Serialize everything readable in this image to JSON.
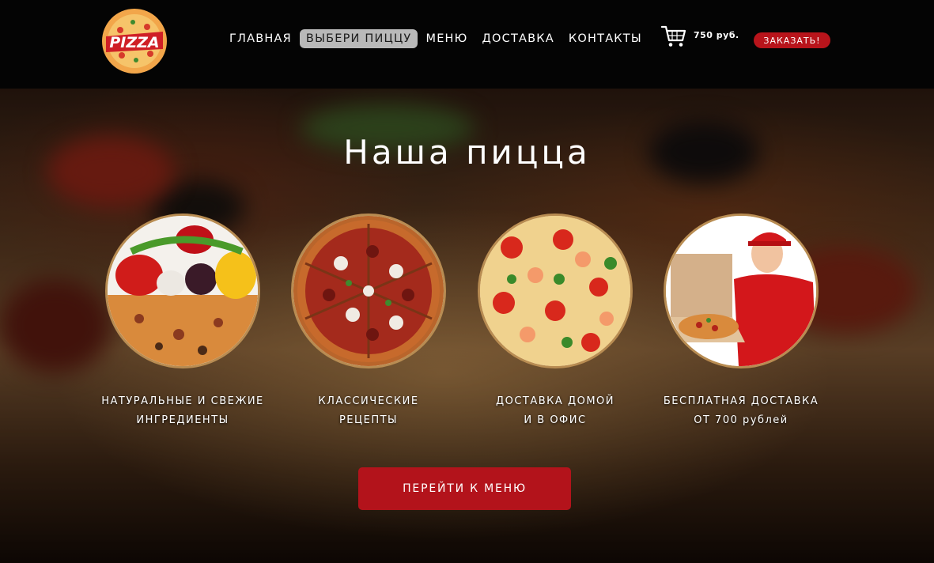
{
  "header": {
    "logo_text": "PIZZA",
    "nav": [
      {
        "label": "ГЛАВНАЯ",
        "active": false
      },
      {
        "label": "ВЫБЕРИ ПИЦЦУ",
        "active": true
      },
      {
        "label": "МЕНЮ",
        "active": false
      },
      {
        "label": "ДОСТАВКА",
        "active": false
      },
      {
        "label": "КОНТАКТЫ",
        "active": false
      }
    ],
    "cart_icon": "shopping-cart-icon",
    "cart_price": "750 руб.",
    "order_label": "ЗАКАЗАТЬ!"
  },
  "hero": {
    "title": "Наша пицца",
    "features": [
      {
        "line1": "НАТУРАЛЬНЫЕ И СВЕЖИЕ",
        "line2": "ИНГРЕДИЕНТЫ",
        "image": "vegetables-and-pizza"
      },
      {
        "line1": "КЛАССИЧЕСКИЕ",
        "line2": "РЕЦЕПТЫ",
        "image": "sliced-pizza"
      },
      {
        "line1": "ДОСТАВКА ДОМОЙ",
        "line2": "И В ОФИС",
        "image": "seafood-pizza"
      },
      {
        "line1": "БЕСПЛАТНАЯ ДОСТАВКА",
        "line2": "ОТ 700 рублей",
        "image": "delivery-man"
      }
    ],
    "button_label": "ПЕРЕЙТИ К МЕНЮ"
  },
  "colors": {
    "accent": "#b8141b",
    "header_bg": "#040404",
    "ring": "#b88c52"
  }
}
